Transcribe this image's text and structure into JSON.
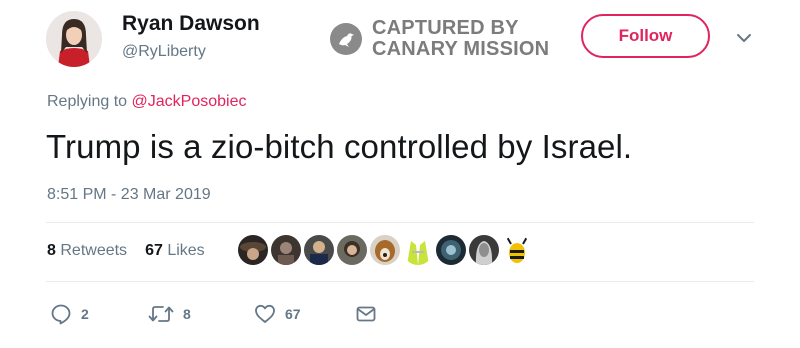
{
  "header": {
    "display_name": "Ryan Dawson",
    "handle": "@RyLiberty",
    "follow_label": "Follow",
    "watermark_line1": "CAPTURED BY",
    "watermark_line2": "CANARY MISSION"
  },
  "tweet": {
    "replying_prefix": "Replying to",
    "replying_to": "@JackPosobiec",
    "text": "Trump is a zio-bitch controlled by Israel.",
    "timestamp": "8:51 PM - 23 Mar 2019"
  },
  "stats": {
    "retweets_count": "8",
    "retweets_label": "Retweets",
    "likes_count": "67",
    "likes_label": "Likes"
  },
  "actions": {
    "reply_count": "2",
    "retweet_count": "8",
    "like_count": "67"
  },
  "icons": {
    "watermark": "canary-bird-icon",
    "more": "chevron-down-icon",
    "reply": "reply-icon",
    "retweet": "retweet-icon",
    "like": "heart-icon",
    "message": "envelope-icon"
  },
  "colors": {
    "accent": "#e0245e",
    "secondary_text": "#657786",
    "primary_text": "#14171a",
    "divider": "#e6ecf0"
  }
}
